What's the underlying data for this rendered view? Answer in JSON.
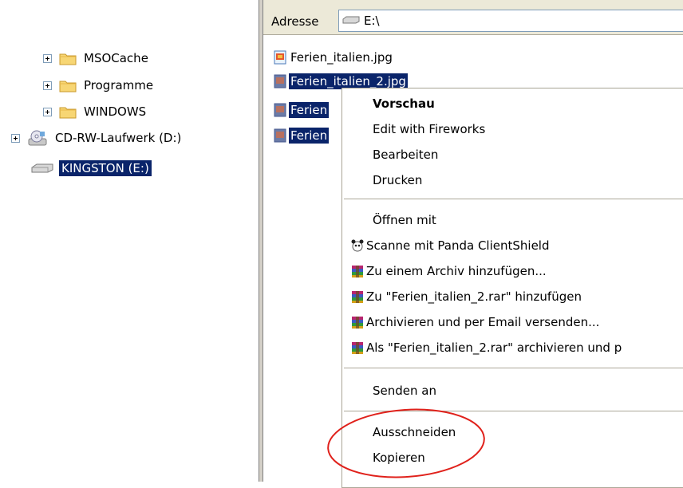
{
  "tree": {
    "items": [
      {
        "label": "MSOCache",
        "type": "folder",
        "expander": true
      },
      {
        "label": "Programme",
        "type": "folder",
        "expander": true
      },
      {
        "label": "WINDOWS",
        "type": "folder",
        "expander": true
      },
      {
        "label": "CD-RW-Laufwerk (D:)",
        "type": "cd-drive",
        "expander": true
      },
      {
        "label": "KINGSTON (E:)",
        "type": "removable-drive",
        "expander": false,
        "selected": true
      }
    ]
  },
  "address_bar": {
    "label": "Adresse",
    "value": "E:\\"
  },
  "files": [
    {
      "name": "Ferien_italien.jpg",
      "selected": false
    },
    {
      "name": "Ferien_italien_2.jpg",
      "selected": true
    },
    {
      "name": "Ferien",
      "selected": true
    },
    {
      "name": "Ferien",
      "selected": true
    }
  ],
  "context_menu": {
    "items": [
      {
        "label": "Vorschau",
        "bold": true
      },
      {
        "label": "Edit with Fireworks"
      },
      {
        "label": "Bearbeiten"
      },
      {
        "label": "Drucken"
      },
      {
        "label": "Öffnen mit"
      },
      {
        "label": "Scanne mit Panda ClientShield",
        "icon": "panda-icon"
      },
      {
        "label": "Zu einem Archiv hinzufügen...",
        "icon": "winrar-icon"
      },
      {
        "label": "Zu \"Ferien_italien_2.rar\" hinzufügen",
        "icon": "winrar-icon"
      },
      {
        "label": "Archivieren und per Email versenden...",
        "icon": "winrar-icon"
      },
      {
        "label": "Als \"Ferien_italien_2.rar\" archivieren und p",
        "icon": "winrar-icon"
      },
      {
        "label": "Senden an"
      },
      {
        "label": "Ausschneiden"
      },
      {
        "label": "Kopieren"
      }
    ]
  },
  "colors": {
    "selection": "#0a246a",
    "highlight_ellipse": "#e0211b",
    "toolbar": "#ece9d8"
  }
}
